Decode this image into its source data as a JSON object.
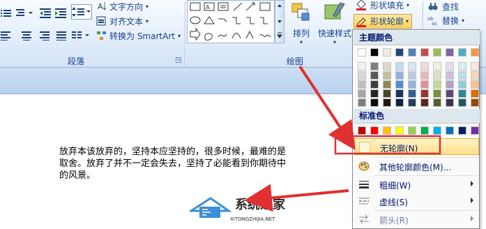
{
  "ribbon": {
    "paragraph_group": {
      "label": "段落",
      "text_direction": "文字方向",
      "align_text": "对齐文本",
      "convert_smartart": "转换为 SmartArt"
    },
    "drawing_group": {
      "label": "绘图",
      "arrange": "排列",
      "quick_styles": "快速样式",
      "shape_fill": "形状填充",
      "shape_outline": "形状轮廓"
    },
    "editing_group": {
      "find": "查找",
      "replace": "替换"
    }
  },
  "menu": {
    "theme_colors_header": "主题颜色",
    "standard_colors_header": "标准色",
    "theme_colors_top": [
      "#ffffff",
      "#000000",
      "#eeece1",
      "#1f497d",
      "#4f81bd",
      "#c0504d",
      "#9bbb59",
      "#8064a2",
      "#4bacc6",
      "#f79646"
    ],
    "theme_shades": [
      [
        "#f2f2f2",
        "#7f7f7f",
        "#ddd9c3",
        "#c6d9f0",
        "#dbe5f1",
        "#f2dcdb",
        "#ebf1dd",
        "#e5e0ec",
        "#dbeef3",
        "#fdeada"
      ],
      [
        "#d8d8d8",
        "#595959",
        "#c4bd97",
        "#8db3e2",
        "#b8cce4",
        "#e5b9b7",
        "#d7e3bc",
        "#ccc1d9",
        "#b7dde8",
        "#fbd5b5"
      ],
      [
        "#bfbfbf",
        "#3f3f3f",
        "#938953",
        "#548dd4",
        "#95b3d7",
        "#d99694",
        "#c3d69b",
        "#b2a2c7",
        "#92cddc",
        "#fac08f"
      ],
      [
        "#a5a5a5",
        "#262626",
        "#494429",
        "#17365d",
        "#366092",
        "#953734",
        "#76923c",
        "#5f497a",
        "#31859b",
        "#e36c09"
      ],
      [
        "#7f7f7f",
        "#0c0c0c",
        "#1d1b10",
        "#0f243e",
        "#244061",
        "#632423",
        "#4f6128",
        "#3f3151",
        "#205867",
        "#974806"
      ]
    ],
    "standard_colors": [
      "#c00000",
      "#ff0000",
      "#ffc000",
      "#ffff00",
      "#92d050",
      "#00b050",
      "#00b0f0",
      "#0070c0",
      "#002060",
      "#7030a0"
    ],
    "items": {
      "no_outline": "无轮廓(N)",
      "more_colors": "其他轮廓颜色(M)...",
      "weight": "粗细(W)",
      "dashes": "虚线(S)",
      "arrows": "箭头(R)"
    }
  },
  "document": {
    "lines": [
      "放弃本该放弃的，坚持本应坚持的，很多时候，最难的是",
      "取舍。放弃了并不一定会失去，坚持了必能看到你期待中",
      "的风景。"
    ]
  },
  "watermark": {
    "title": "系统之家",
    "subtitle": "XITONGZHIJIA.NET"
  },
  "colors": {
    "ribbon_text": "#15428b",
    "highlight_box": "#e03030",
    "annotation_arrow": "#e03030",
    "menu_hover": "#ffe79c"
  }
}
